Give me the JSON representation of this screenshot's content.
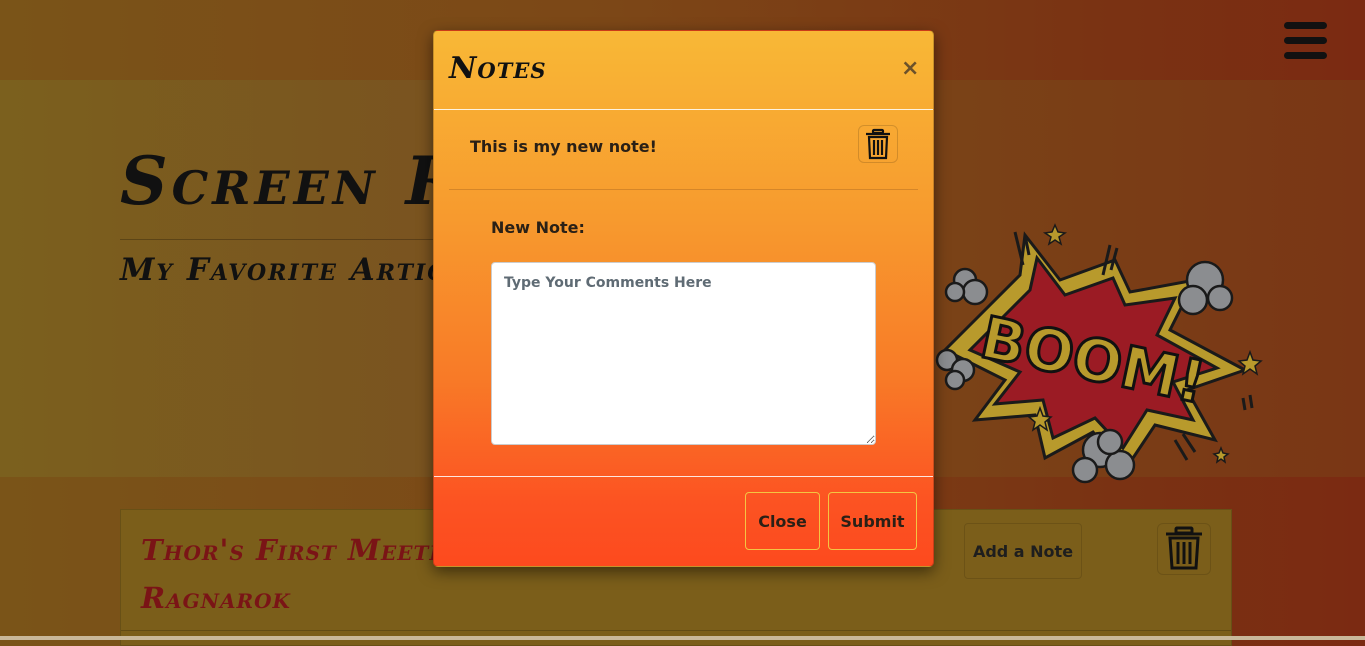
{
  "header": {
    "menu_icon": "hamburger-menu-icon"
  },
  "hero": {
    "title": "Screen Ra",
    "subtitle": "My Favorite Article",
    "image": {
      "name": "boom-comic-explosion",
      "text": "BOOM!"
    }
  },
  "article": {
    "title": "Thor's First Meetin Up In Ragnarok",
    "add_note_label": "Add a Note",
    "delete_icon": "trash-icon"
  },
  "modal": {
    "title": "Notes",
    "close_glyph": "×",
    "notes": [
      {
        "text": "This is my new note!",
        "delete_icon": "trash-icon"
      }
    ],
    "new_note_label": "New Note:",
    "input_placeholder": "Type Your Comments Here",
    "input_value": "",
    "close_label": "Close",
    "submit_label": "Submit"
  },
  "colors": {
    "modal_top": "#f8b836",
    "modal_bottom": "#fd4a1e",
    "article_title": "#7a1416",
    "boom_red": "#9b1b24",
    "boom_gold": "#b89a2c"
  }
}
